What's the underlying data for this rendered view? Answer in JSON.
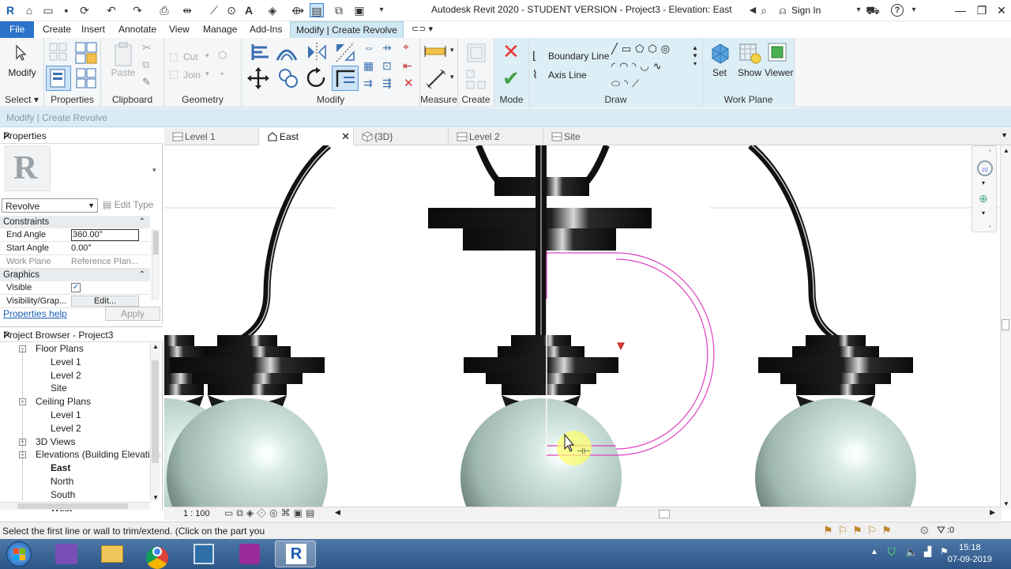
{
  "window": {
    "title": "Autodesk Revit 2020 - STUDENT VERSION - Project3 - Elevation: East",
    "sign_in": "Sign In"
  },
  "ribbon_tabs": [
    "File",
    "Create",
    "Insert",
    "Annotate",
    "View",
    "Manage",
    "Add-Ins",
    "Modify | Create Revolve"
  ],
  "ribbon": {
    "select": {
      "modify_label": "Modify",
      "panel_label": "Select"
    },
    "properties": {
      "panel_label": "Properties"
    },
    "clipboard": {
      "paste_label": "Paste",
      "panel_label": "Clipboard"
    },
    "geometry": {
      "cut_label": "Cut",
      "join_label": "Join",
      "panel_label": "Geometry"
    },
    "modify": {
      "panel_label": "Modify"
    },
    "measure": {
      "panel_label": "Measure"
    },
    "create": {
      "panel_label": "Create"
    },
    "mode": {
      "panel_label": "Mode"
    },
    "draw": {
      "boundary_line": "Boundary Line",
      "axis_line": "Axis Line",
      "panel_label": "Draw"
    },
    "work_plane": {
      "set": "Set",
      "show": "Show",
      "viewer": "Viewer",
      "panel_label": "Work Plane"
    }
  },
  "options_bar": {
    "text": "Modify | Create Revolve"
  },
  "properties": {
    "title": "Properties",
    "type_selector": "Revolve",
    "edit_type": "Edit Type",
    "sections": [
      {
        "name": "Constraints",
        "rows": [
          {
            "key": "End Angle",
            "value": "360.00°"
          },
          {
            "key": "Start Angle",
            "value": "0.00°"
          },
          {
            "key": "Work Plane",
            "value": "Reference Plan..."
          }
        ]
      },
      {
        "name": "Graphics",
        "rows": [
          {
            "key": "Visible",
            "value": "✓"
          },
          {
            "key": "Visibility/Grap...",
            "value": "Edit..."
          }
        ]
      }
    ],
    "help_link": "Properties help",
    "apply": "Apply"
  },
  "project_browser": {
    "title": "Project Browser - Project3",
    "nodes": [
      {
        "label": "Floor Plans",
        "level": 1,
        "expander": "−"
      },
      {
        "label": "Level 1",
        "level": 2
      },
      {
        "label": "Level 2",
        "level": 2
      },
      {
        "label": "Site",
        "level": 2
      },
      {
        "label": "Ceiling Plans",
        "level": 1,
        "expander": "−"
      },
      {
        "label": "Level 1",
        "level": 2
      },
      {
        "label": "Level 2",
        "level": 2
      },
      {
        "label": "3D Views",
        "level": 1,
        "expander": "+"
      },
      {
        "label": "Elevations (Building Elevation",
        "level": 1,
        "expander": "−"
      },
      {
        "label": "East",
        "level": 2,
        "bold": true
      },
      {
        "label": "North",
        "level": 2
      },
      {
        "label": "South",
        "level": 2
      },
      {
        "label": "West",
        "level": 2
      }
    ]
  },
  "view_tabs": [
    {
      "label": "Level 1",
      "active": false
    },
    {
      "label": "East",
      "active": true
    },
    {
      "label": "{3D}",
      "active": false
    },
    {
      "label": "Level 2",
      "active": false
    },
    {
      "label": "Site",
      "active": false
    }
  ],
  "view_control": {
    "scale": "1 : 100"
  },
  "status": {
    "message": "Select the first line or wall to trim/extend.  (Click on the part you",
    "filter_count": ":0"
  },
  "taskbar": {
    "time": "15:18",
    "date": "07-09-2019"
  },
  "colors": {
    "accent": "#2a73c9",
    "sketch": "#e040c0",
    "ribbon_context": "#dceef6",
    "taskbar": "#2d5587"
  }
}
